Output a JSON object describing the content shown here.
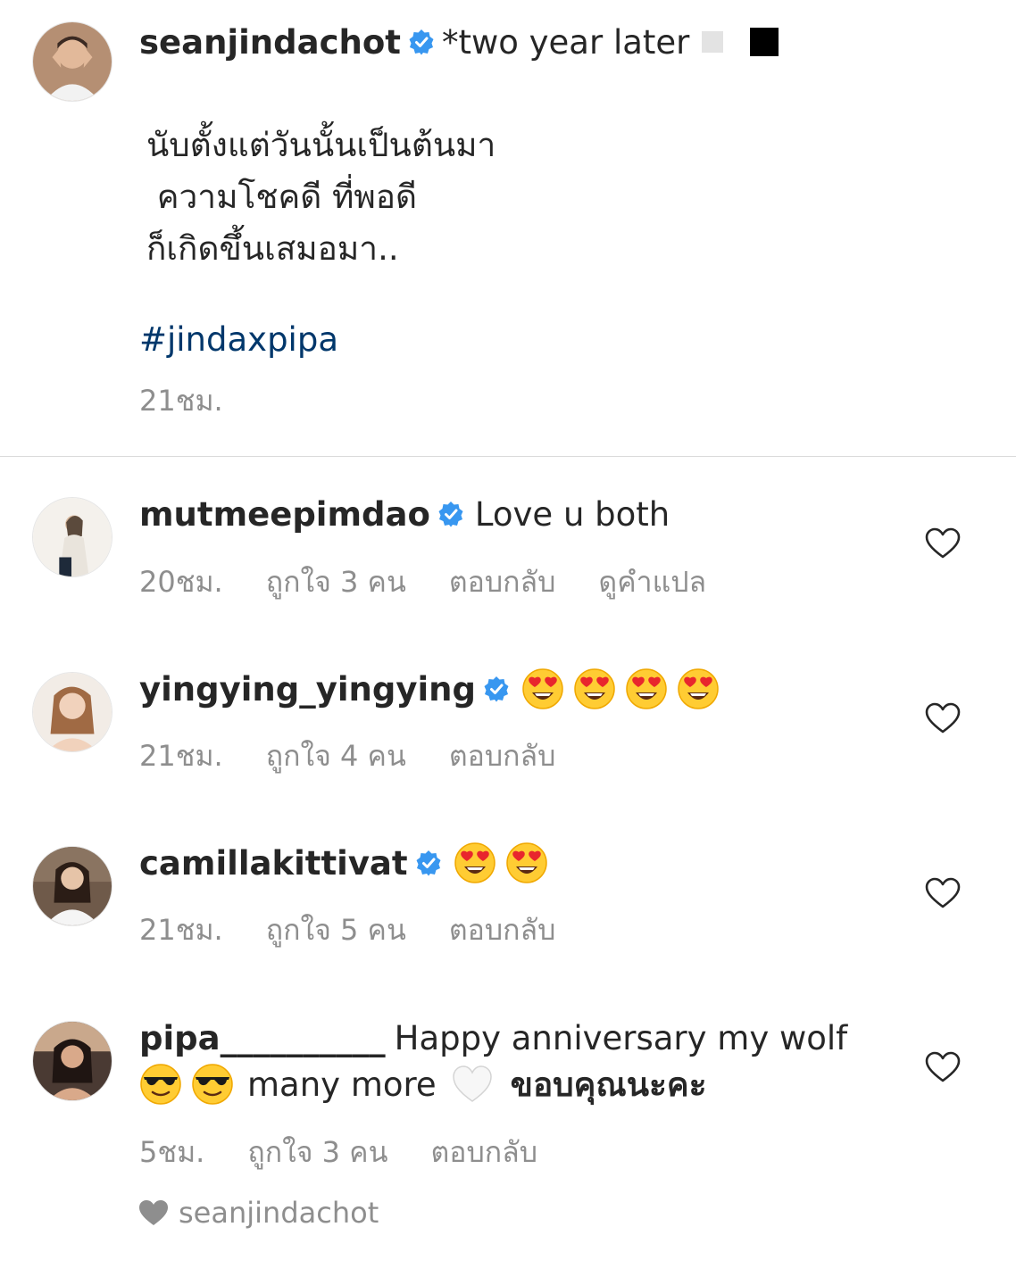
{
  "caption": {
    "username": "seanjindachot",
    "first_line": "*two year later",
    "thai_lines": "นับตั้งแต่วันนั้นเป็นต้นมา\n ความโชคดี ที่พอดี\nก็เกิดขึ้นเสมอมา..",
    "hashtag": "#jindaxpipa",
    "time": "21ชม."
  },
  "comments": [
    {
      "username": "mutmeepimdao",
      "verified": true,
      "text": "Love u both",
      "time": "20ชม.",
      "likes": "ถูกใจ 3 คน",
      "reply": "ตอบกลับ",
      "translate": "ดูคำแปล"
    },
    {
      "username": "yingying_yingying",
      "verified": true,
      "emoji": "heart-eyes-emoji",
      "emoji_count": 4,
      "time": "21ชม.",
      "likes": "ถูกใจ 4 คน",
      "reply": "ตอบกลับ"
    },
    {
      "username": "camillakittivat",
      "verified": true,
      "emoji": "heart-eyes-emoji",
      "emoji_count": 2,
      "time": "21ชม.",
      "likes": "ถูกใจ 5 คน",
      "reply": "ตอบกลับ"
    },
    {
      "username": "pipa__________",
      "verified": false,
      "text_line1": "Happy anniversary my wolf",
      "text_many_more": "many more",
      "text_thanks": "ขอบคุณนะคะ",
      "time": "5ชม.",
      "likes": "ถูกใจ 3 คน",
      "reply": "ตอบกลับ"
    }
  ],
  "liked_by_author": "seanjindachot",
  "colors": {
    "verified_blue": "#3897f0",
    "hashtag": "#00376b",
    "meta_gray": "#8e8e8e",
    "text": "#262626"
  }
}
